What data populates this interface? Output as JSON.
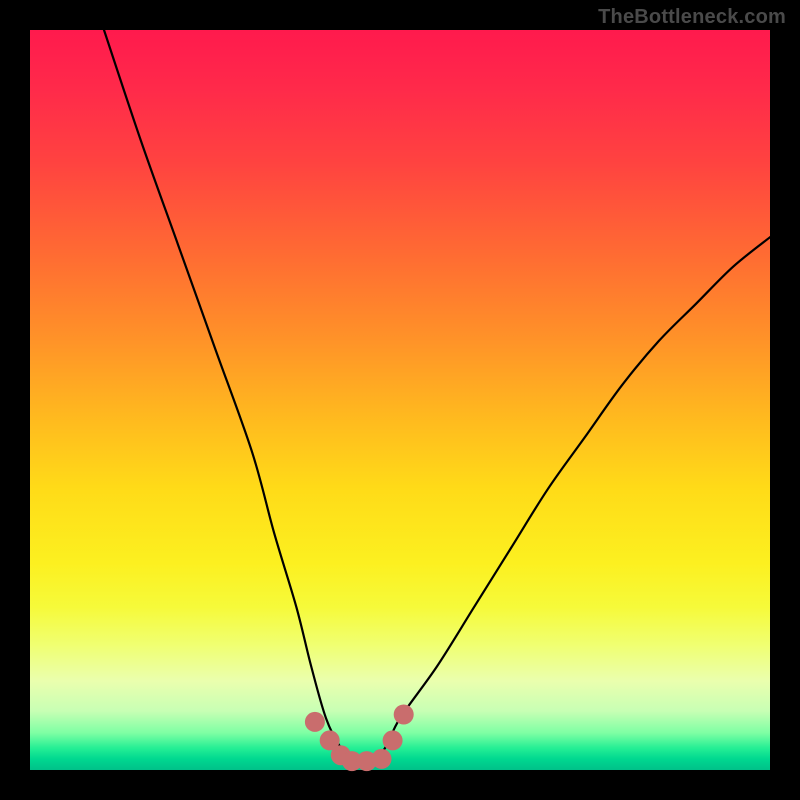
{
  "watermark": "TheBottleneck.com",
  "chart_data": {
    "type": "line",
    "title": "",
    "xlabel": "",
    "ylabel": "",
    "ylim": [
      0,
      100
    ],
    "xlim": [
      0,
      100
    ],
    "series": [
      {
        "name": "curve",
        "x": [
          10,
          15,
          20,
          25,
          30,
          33,
          36,
          38,
          40,
          42,
          44,
          46,
          48,
          50,
          55,
          60,
          65,
          70,
          75,
          80,
          85,
          90,
          95,
          100
        ],
        "values": [
          100,
          85,
          71,
          57,
          43,
          32,
          22,
          14,
          7,
          3,
          1,
          1,
          3,
          7,
          14,
          22,
          30,
          38,
          45,
          52,
          58,
          63,
          68,
          72
        ]
      }
    ],
    "markers": {
      "name": "bottom-dots",
      "color": "#c96d6d",
      "points": [
        {
          "x": 38.5,
          "y": 6.5
        },
        {
          "x": 40.5,
          "y": 4.0
        },
        {
          "x": 42.0,
          "y": 2.0
        },
        {
          "x": 43.5,
          "y": 1.2
        },
        {
          "x": 45.5,
          "y": 1.2
        },
        {
          "x": 47.5,
          "y": 1.5
        },
        {
          "x": 49.0,
          "y": 4.0
        },
        {
          "x": 50.5,
          "y": 7.5
        }
      ]
    }
  }
}
